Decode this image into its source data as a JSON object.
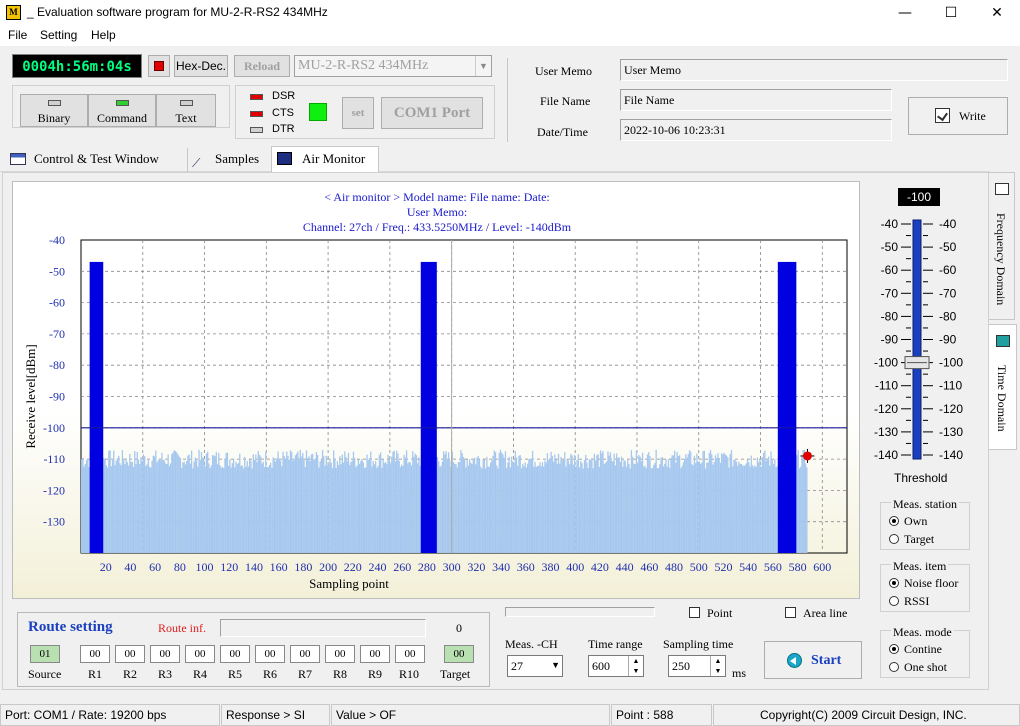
{
  "window": {
    "icon_glyph": "M",
    "title": "_  Evaluation software program for MU-2-R-RS2  434MHz",
    "minimize": "—",
    "maximize": "☐",
    "close": "✕"
  },
  "menu": [
    "File",
    "Setting",
    "Help"
  ],
  "toolbar": {
    "timer": "0004h:56m:04s",
    "hexdec": "Hex-Dec.",
    "reload": "Reload",
    "model": "MU-2-R-RS2  434MHz",
    "modes": [
      "Binary",
      "Command",
      "Text"
    ],
    "signals": [
      "DSR",
      "CTS",
      "DTR"
    ],
    "set": "set",
    "com_port": "COM1 Port"
  },
  "memo": {
    "user_memo_label": "User Memo",
    "user_memo_value": "User Memo",
    "file_name_label": "File Name",
    "file_name_value": "File Name",
    "datetime_label": "Date/Time",
    "datetime_value": "2022-10-06 10:23:31",
    "write": "Write"
  },
  "tabs": [
    "Control  & Test Window",
    "Samples",
    "Air Monitor"
  ],
  "side_tabs": [
    "Frequency Domain",
    "Time Domain"
  ],
  "chart_header": {
    "line1": "< Air monitor >   Model name:     File name:     Date:",
    "line2": "User Memo:",
    "line3": "Channel: 27ch  /  Freq.: 433.5250MHz  /  Level:  -140dBm"
  },
  "chart_data": {
    "type": "bar",
    "xlabel": "Sampling point",
    "ylabel": "Receive level[dBm]",
    "xlim": [
      0,
      620
    ],
    "ylim": [
      -140,
      -40
    ],
    "xticks": [
      20,
      40,
      60,
      80,
      100,
      120,
      140,
      160,
      180,
      200,
      220,
      240,
      260,
      280,
      300,
      320,
      340,
      360,
      380,
      400,
      420,
      440,
      460,
      480,
      500,
      520,
      540,
      560,
      580,
      600
    ],
    "yticks": [
      -40,
      -50,
      -60,
      -70,
      -80,
      -90,
      -100,
      -110,
      -120,
      -130
    ],
    "threshold": -100,
    "noise_floor_range": [
      -113,
      -107
    ],
    "noise_start": 0,
    "noise_end": 588,
    "bursts": [
      {
        "x_start": 0,
        "x_end": 7,
        "value": -113
      },
      {
        "x_start": 7,
        "x_end": 18,
        "value": -47
      },
      {
        "x_start": 275,
        "x_end": 288,
        "value": -47
      },
      {
        "x_start": 564,
        "x_end": 579,
        "value": -47
      }
    ],
    "cursor_x": 300,
    "marker": {
      "x": 588,
      "y": -109
    },
    "colors": {
      "noise": "#a6c8ef",
      "burst": "#0000e0",
      "threshold": "#1a1a9a",
      "marker": "#e00000"
    }
  },
  "threshold_panel": {
    "value": "-100",
    "scale": [
      "-40",
      "-50",
      "-60",
      "-70",
      "-80",
      "-90",
      "-100",
      "-110",
      "-120",
      "-130",
      "-140"
    ],
    "label": "Threshold",
    "level": -100
  },
  "meas_station": {
    "title": "Meas. station",
    "options": [
      "Own",
      "Target"
    ],
    "selected": 0
  },
  "meas_item": {
    "title": "Meas. item",
    "options": [
      "Noise floor",
      "RSSI"
    ],
    "selected": 0
  },
  "meas_mode": {
    "title": "Meas. mode",
    "options": [
      "Contine",
      "One shot"
    ],
    "selected": 0
  },
  "route": {
    "title": "Route setting",
    "inf_label": "Route inf.",
    "count": "0",
    "source_value": "01",
    "relays": [
      "00",
      "00",
      "00",
      "00",
      "00",
      "00",
      "00",
      "00",
      "00",
      "00"
    ],
    "target_value": "00",
    "source_label": "Source",
    "relay_labels": [
      "R1",
      "R2",
      "R3",
      "R4",
      "R5",
      "R6",
      "R7",
      "R8",
      "R9",
      "R10"
    ],
    "target_label": "Target"
  },
  "controls": {
    "point": "Point",
    "area_line": "Area line",
    "meas_ch_label": "Meas. -CH",
    "meas_ch": "27",
    "time_range_label": "Time range",
    "time_range": "600",
    "sampling_label": "Sampling time",
    "sampling": "250",
    "ms": "ms",
    "start": "Start"
  },
  "status": {
    "port": "Port: COM1 / Rate: 19200 bps",
    "response": "Response > SI",
    "value": "Value > OF",
    "point": "Point : 588",
    "copyright": "Copyright(C) 2009 Circuit Design, INC."
  }
}
